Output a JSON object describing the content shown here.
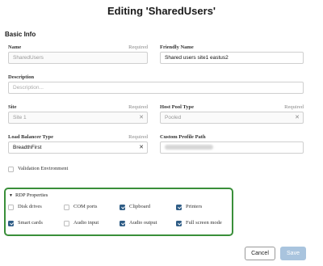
{
  "dialog": {
    "title": "Editing 'SharedUsers'"
  },
  "basic_info": {
    "section_title": "Basic Info",
    "name": {
      "label": "Name",
      "required": "Required",
      "value": "SharedUsers"
    },
    "friendly_name": {
      "label": "Friendly Name",
      "value": "Shared users site1 eastus2"
    },
    "description": {
      "label": "Description",
      "placeholder": "Description..."
    },
    "site": {
      "label": "Site",
      "required": "Required",
      "value": "Site 1"
    },
    "host_pool_type": {
      "label": "Host Pool Type",
      "required": "Required",
      "value": "Pooled"
    },
    "load_balancer_type": {
      "label": "Load Balancer Type",
      "required": "Required",
      "value": "BreadthFirst"
    },
    "custom_profile_path": {
      "label": "Custom Profile Path"
    },
    "validation_environment": {
      "label": "Validation Environment",
      "checked": false
    }
  },
  "rdp": {
    "title": "RDP Properties",
    "options": [
      {
        "label": "Disk drives",
        "checked": false
      },
      {
        "label": "COM ports",
        "checked": false
      },
      {
        "label": "Clipboard",
        "checked": true
      },
      {
        "label": "Printers",
        "checked": true
      },
      {
        "label": "Smart cards",
        "checked": true
      },
      {
        "label": "Audio input",
        "checked": false
      },
      {
        "label": "Audio output",
        "checked": true
      },
      {
        "label": "Full screen mode",
        "checked": true
      }
    ]
  },
  "buttons": {
    "cancel": "Cancel",
    "save": "Save"
  },
  "icons": {
    "clear": "close-icon",
    "caret": "caret-down-icon",
    "check": "checkmark-icon"
  },
  "colors": {
    "accent": "#2f5d86",
    "highlight_border": "#3a8f3a",
    "save_disabled": "#a9c4de"
  }
}
